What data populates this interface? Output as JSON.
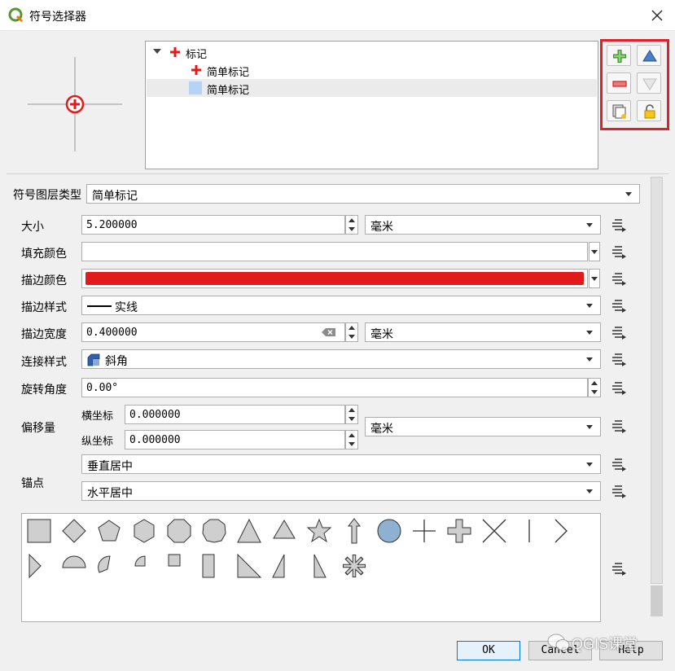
{
  "window": {
    "title": "符号选择器",
    "close_icon": "close-icon"
  },
  "tree": {
    "root_label": "标记",
    "layers": [
      {
        "label": "简单标记",
        "icon": "red-plus-icon"
      },
      {
        "label": "简单标记",
        "icon": "fill-swatch-icon",
        "selected": true
      }
    ]
  },
  "toolbar": {
    "add_icon": "add-layer-icon",
    "remove_icon": "remove-layer-icon",
    "duplicate_icon": "duplicate-layer-icon",
    "up_icon": "move-up-icon",
    "down_icon": "move-down-icon",
    "lock_icon": "lock-icon"
  },
  "layer_type": {
    "label": "符号图层类型",
    "value": "简单标记"
  },
  "properties": {
    "size": {
      "label": "大小",
      "value": "5.200000",
      "unit": "毫米"
    },
    "fill_color": {
      "label": "填充颜色",
      "color": "#ffffff"
    },
    "stroke_color": {
      "label": "描边颜色",
      "color": "#e31a1c"
    },
    "stroke_style": {
      "label": "描边样式",
      "value": "实线"
    },
    "stroke_width": {
      "label": "描边宽度",
      "value": "0.400000",
      "unit": "毫米"
    },
    "join_style": {
      "label": "连接样式",
      "value": "斜角"
    },
    "rotation": {
      "label": "旋转角度",
      "value": "0.00°"
    },
    "offset": {
      "label": "偏移量",
      "x_label": "横坐标",
      "x_value": "0.000000",
      "y_label": "纵坐标",
      "y_value": "0.000000",
      "unit": "毫米"
    },
    "anchor": {
      "label": "锚点",
      "vertical": "垂直居中",
      "horizontal": "水平居中"
    }
  },
  "colors": {
    "accent_red": "#e0212a",
    "marker_fill": "#cfcfcf",
    "circle_fill": "#8fb1d1"
  },
  "buttons": {
    "ok": "OK",
    "cancel": "Cancel",
    "help": "Help"
  },
  "watermark": "QGIS课堂"
}
